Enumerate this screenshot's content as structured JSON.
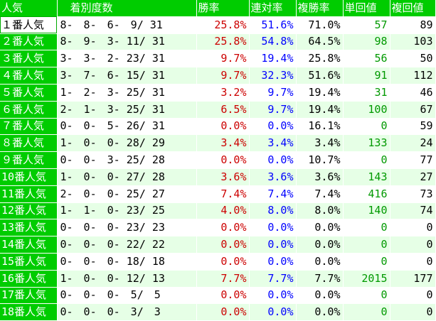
{
  "chart_data": {
    "type": "table",
    "columns": [
      "人気",
      "着別度数",
      "勝率",
      "連対率",
      "複勝率",
      "単回値",
      "複回値"
    ],
    "rows": [
      {
        "popularity": "１番人気",
        "record": "8-　8-　6-　9/ 31",
        "win_rate": "25.8%",
        "place_rate": "51.6%",
        "show_rate": "71.0%",
        "win_return": "57",
        "show_return": "89"
      },
      {
        "popularity": "２番人気",
        "record": "8-　9-　3- 11/ 31",
        "win_rate": "25.8%",
        "place_rate": "54.8%",
        "show_rate": "64.5%",
        "win_return": "98",
        "show_return": "103"
      },
      {
        "popularity": "３番人気",
        "record": "3-　3-　2- 23/ 31",
        "win_rate": "9.7%",
        "place_rate": "19.4%",
        "show_rate": "25.8%",
        "win_return": "56",
        "show_return": "50"
      },
      {
        "popularity": "４番人気",
        "record": "3-　7-　6- 15/ 31",
        "win_rate": "9.7%",
        "place_rate": "32.3%",
        "show_rate": "51.6%",
        "win_return": "91",
        "show_return": "112"
      },
      {
        "popularity": "５番人気",
        "record": "1-　2-　3- 25/ 31",
        "win_rate": "3.2%",
        "place_rate": "9.7%",
        "show_rate": "19.4%",
        "win_return": "31",
        "show_return": "46"
      },
      {
        "popularity": "６番人気",
        "record": "2-　1-　3- 25/ 31",
        "win_rate": "6.5%",
        "place_rate": "9.7%",
        "show_rate": "19.4%",
        "win_return": "100",
        "show_return": "67"
      },
      {
        "popularity": "７番人気",
        "record": "0-　0-　5- 26/ 31",
        "win_rate": "0.0%",
        "place_rate": "0.0%",
        "show_rate": "16.1%",
        "win_return": "0",
        "show_return": "59"
      },
      {
        "popularity": "８番人気",
        "record": "1-　0-　0- 28/ 29",
        "win_rate": "3.4%",
        "place_rate": "3.4%",
        "show_rate": "3.4%",
        "win_return": "133",
        "show_return": "24"
      },
      {
        "popularity": "９番人気",
        "record": "0-　0-　3- 25/ 28",
        "win_rate": "0.0%",
        "place_rate": "0.0%",
        "show_rate": "10.7%",
        "win_return": "0",
        "show_return": "77"
      },
      {
        "popularity": "10番人気",
        "record": "1-　0-　0- 27/ 28",
        "win_rate": "3.6%",
        "place_rate": "3.6%",
        "show_rate": "3.6%",
        "win_return": "143",
        "show_return": "27"
      },
      {
        "popularity": "11番人気",
        "record": "2-　0-　0- 25/ 27",
        "win_rate": "7.4%",
        "place_rate": "7.4%",
        "show_rate": "7.4%",
        "win_return": "416",
        "show_return": "73"
      },
      {
        "popularity": "12番人気",
        "record": "1-　1-　0- 23/ 25",
        "win_rate": "4.0%",
        "place_rate": "8.0%",
        "show_rate": "8.0%",
        "win_return": "140",
        "show_return": "74"
      },
      {
        "popularity": "13番人気",
        "record": "0-　0-　0- 23/ 23",
        "win_rate": "0.0%",
        "place_rate": "0.0%",
        "show_rate": "0.0%",
        "win_return": "0",
        "show_return": "0"
      },
      {
        "popularity": "14番人気",
        "record": "0-　0-　0- 22/ 22",
        "win_rate": "0.0%",
        "place_rate": "0.0%",
        "show_rate": "0.0%",
        "win_return": "0",
        "show_return": "0"
      },
      {
        "popularity": "15番人気",
        "record": "0-　0-　0- 18/ 18",
        "win_rate": "0.0%",
        "place_rate": "0.0%",
        "show_rate": "0.0%",
        "win_return": "0",
        "show_return": "0"
      },
      {
        "popularity": "16番人気",
        "record": "1-　0-　0- 12/ 13",
        "win_rate": "7.7%",
        "place_rate": "7.7%",
        "show_rate": "7.7%",
        "win_return": "2015",
        "show_return": "177"
      },
      {
        "popularity": "17番人気",
        "record": "0-　0-　0-　5/　5",
        "win_rate": "0.0%",
        "place_rate": "0.0%",
        "show_rate": "0.0%",
        "win_return": "0",
        "show_return": "0"
      },
      {
        "popularity": "18番人気",
        "record": "0-　0-　0-　3/　3",
        "win_rate": "0.0%",
        "place_rate": "0.0%",
        "show_rate": "0.0%",
        "win_return": "0",
        "show_return": "0"
      }
    ]
  },
  "colors": {
    "header_bg": "#00cc00",
    "win_rate": "#cc0000",
    "place_rate": "#0000ff",
    "win_return": "#009900",
    "row_alt": "#e6ffe6"
  }
}
